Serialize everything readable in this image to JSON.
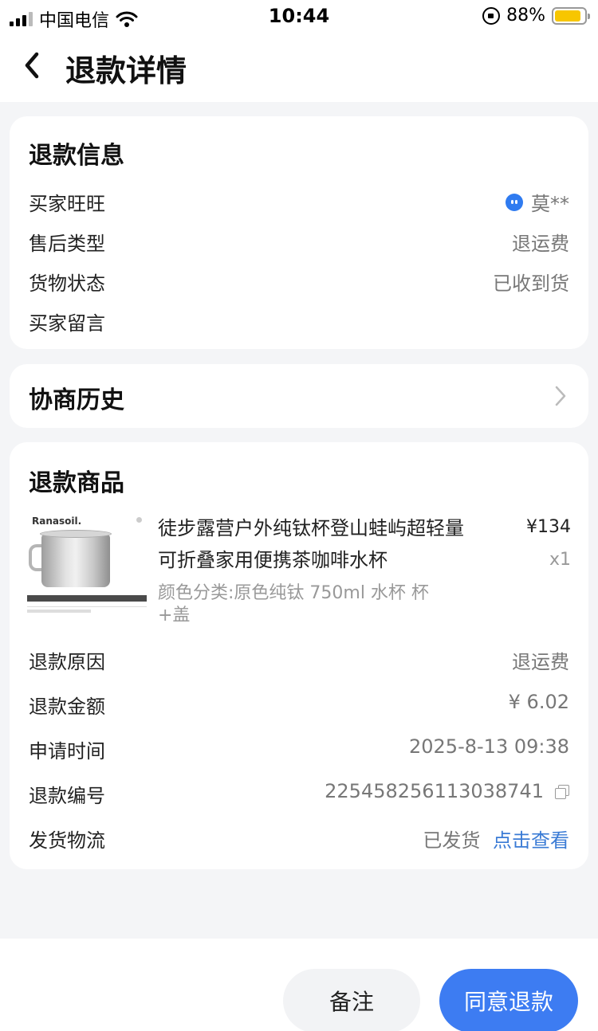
{
  "status_bar": {
    "carrier": "中国电信",
    "time": "10:44",
    "battery_percent": "88%",
    "battery_level": 0.88,
    "icons": [
      "signal-icon",
      "wifi-icon",
      "orientation-lock-icon",
      "battery-icon"
    ]
  },
  "nav": {
    "title": "退款详情",
    "back_icon": "chevron-left-icon"
  },
  "refund_info": {
    "title": "退款信息",
    "rows": [
      {
        "label": "买家旺旺",
        "value": "莫**"
      },
      {
        "label": "售后类型",
        "value": "退运费"
      },
      {
        "label": "货物状态",
        "value": "已收到货"
      },
      {
        "label": "买家留言",
        "value": ""
      }
    ]
  },
  "history": {
    "title": "协商历史"
  },
  "goods": {
    "title": "退款商品",
    "product": {
      "brand": "Ranasoil.",
      "name": "徒步露营户外纯钛杯登山蛙屿超轻量可折叠家用便携茶咖啡水杯",
      "price": "¥134",
      "quantity": "x1",
      "sku": "颜色分类:原色纯钛 750ml 水杯 杯+盖"
    },
    "rows": [
      {
        "label": "退款原因",
        "value": "退运费"
      },
      {
        "label": "退款金额",
        "value": "¥ 6.02"
      },
      {
        "label": "申请时间",
        "value": "2025-8-13 09:38"
      },
      {
        "label": "退款编号",
        "value": "225458256113038741"
      },
      {
        "label": "发货物流",
        "value": "已发货",
        "link": "点击查看"
      }
    ]
  },
  "actions": {
    "remark": "备注",
    "agree": "同意退款"
  },
  "colors": {
    "accent": "#3d7cf2",
    "link": "#3a7bd5",
    "background": "#f4f5f7"
  }
}
